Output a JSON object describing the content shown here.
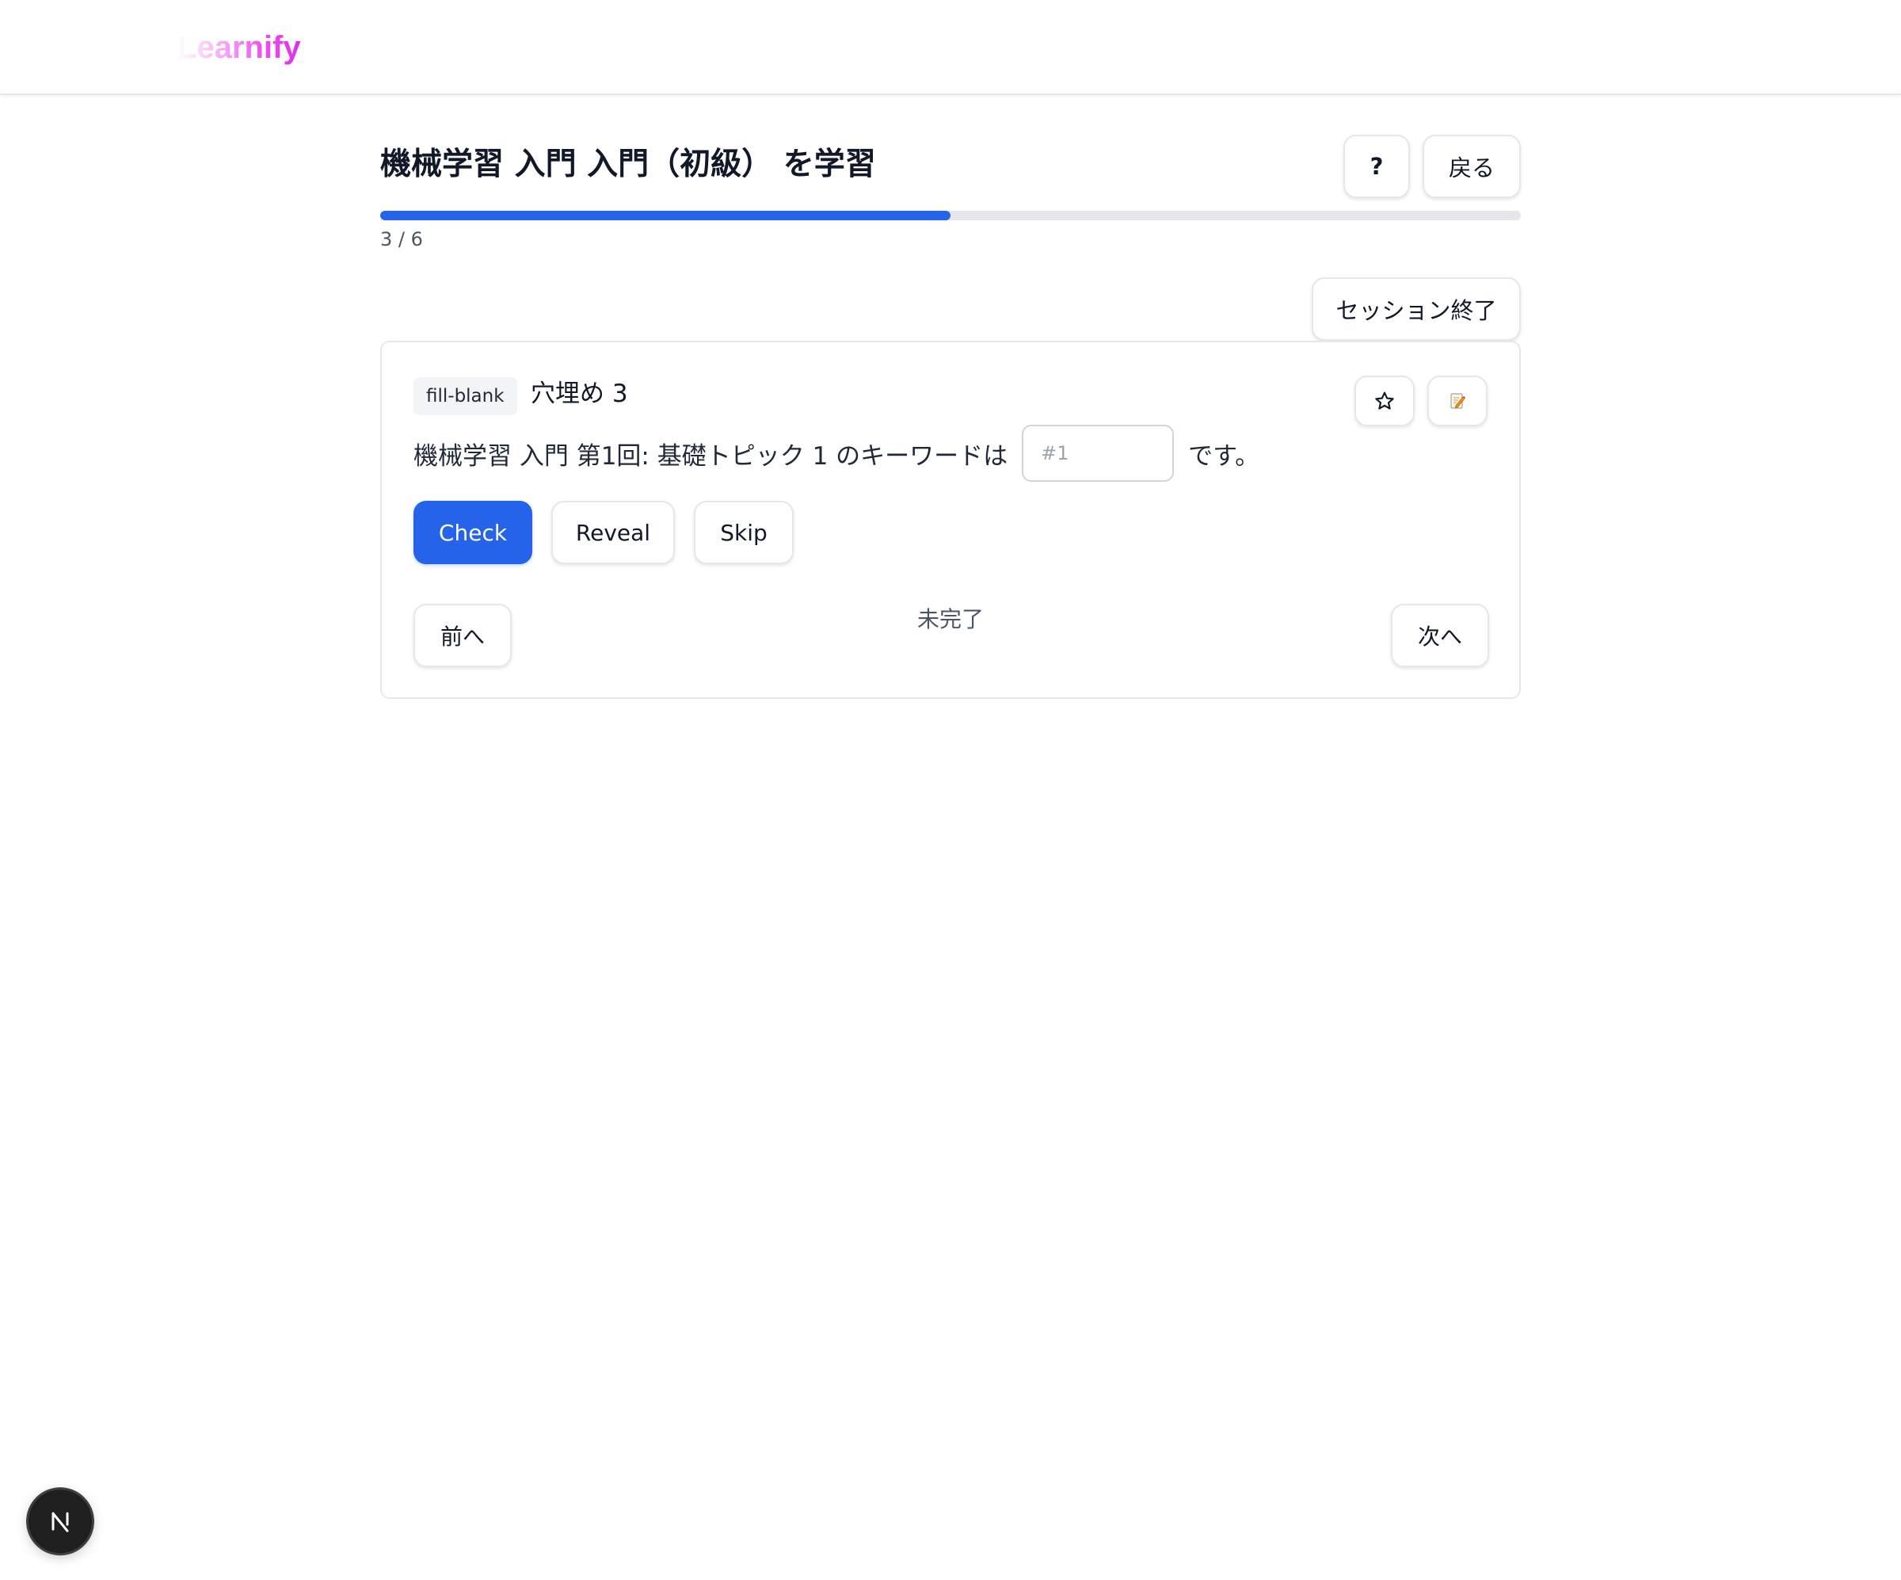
{
  "header": {
    "logo_text": "Learnify"
  },
  "study": {
    "title": "機械学習 入門 入門（初級） を学習",
    "help_label": "?",
    "back_label": "戻る",
    "progress_current": 3,
    "progress_total": 6,
    "progress_text": "3 / 6",
    "progress_fraction": 0.5,
    "end_session_label": "セッション終了"
  },
  "card": {
    "type_badge": "fill-blank",
    "title": "穴埋め 3",
    "question_prefix": "機械学習 入門 第1回: 基礎トピック 1 のキーワードは",
    "blank_placeholder": "#1",
    "blank_value": "",
    "question_suffix": "です。",
    "check_label": "Check",
    "reveal_label": "Reveal",
    "skip_label": "Skip",
    "prev_label": "前へ",
    "next_label": "次へ",
    "status": "未完了"
  },
  "icons": {
    "favorite": "star-icon",
    "note": "memo-icon",
    "dev_badge": "nextjs-logo-icon"
  },
  "colors": {
    "primary": "#2563eb",
    "progress_track": "#e5e7eb",
    "logo_gradient_end": "#dc2fe8"
  }
}
